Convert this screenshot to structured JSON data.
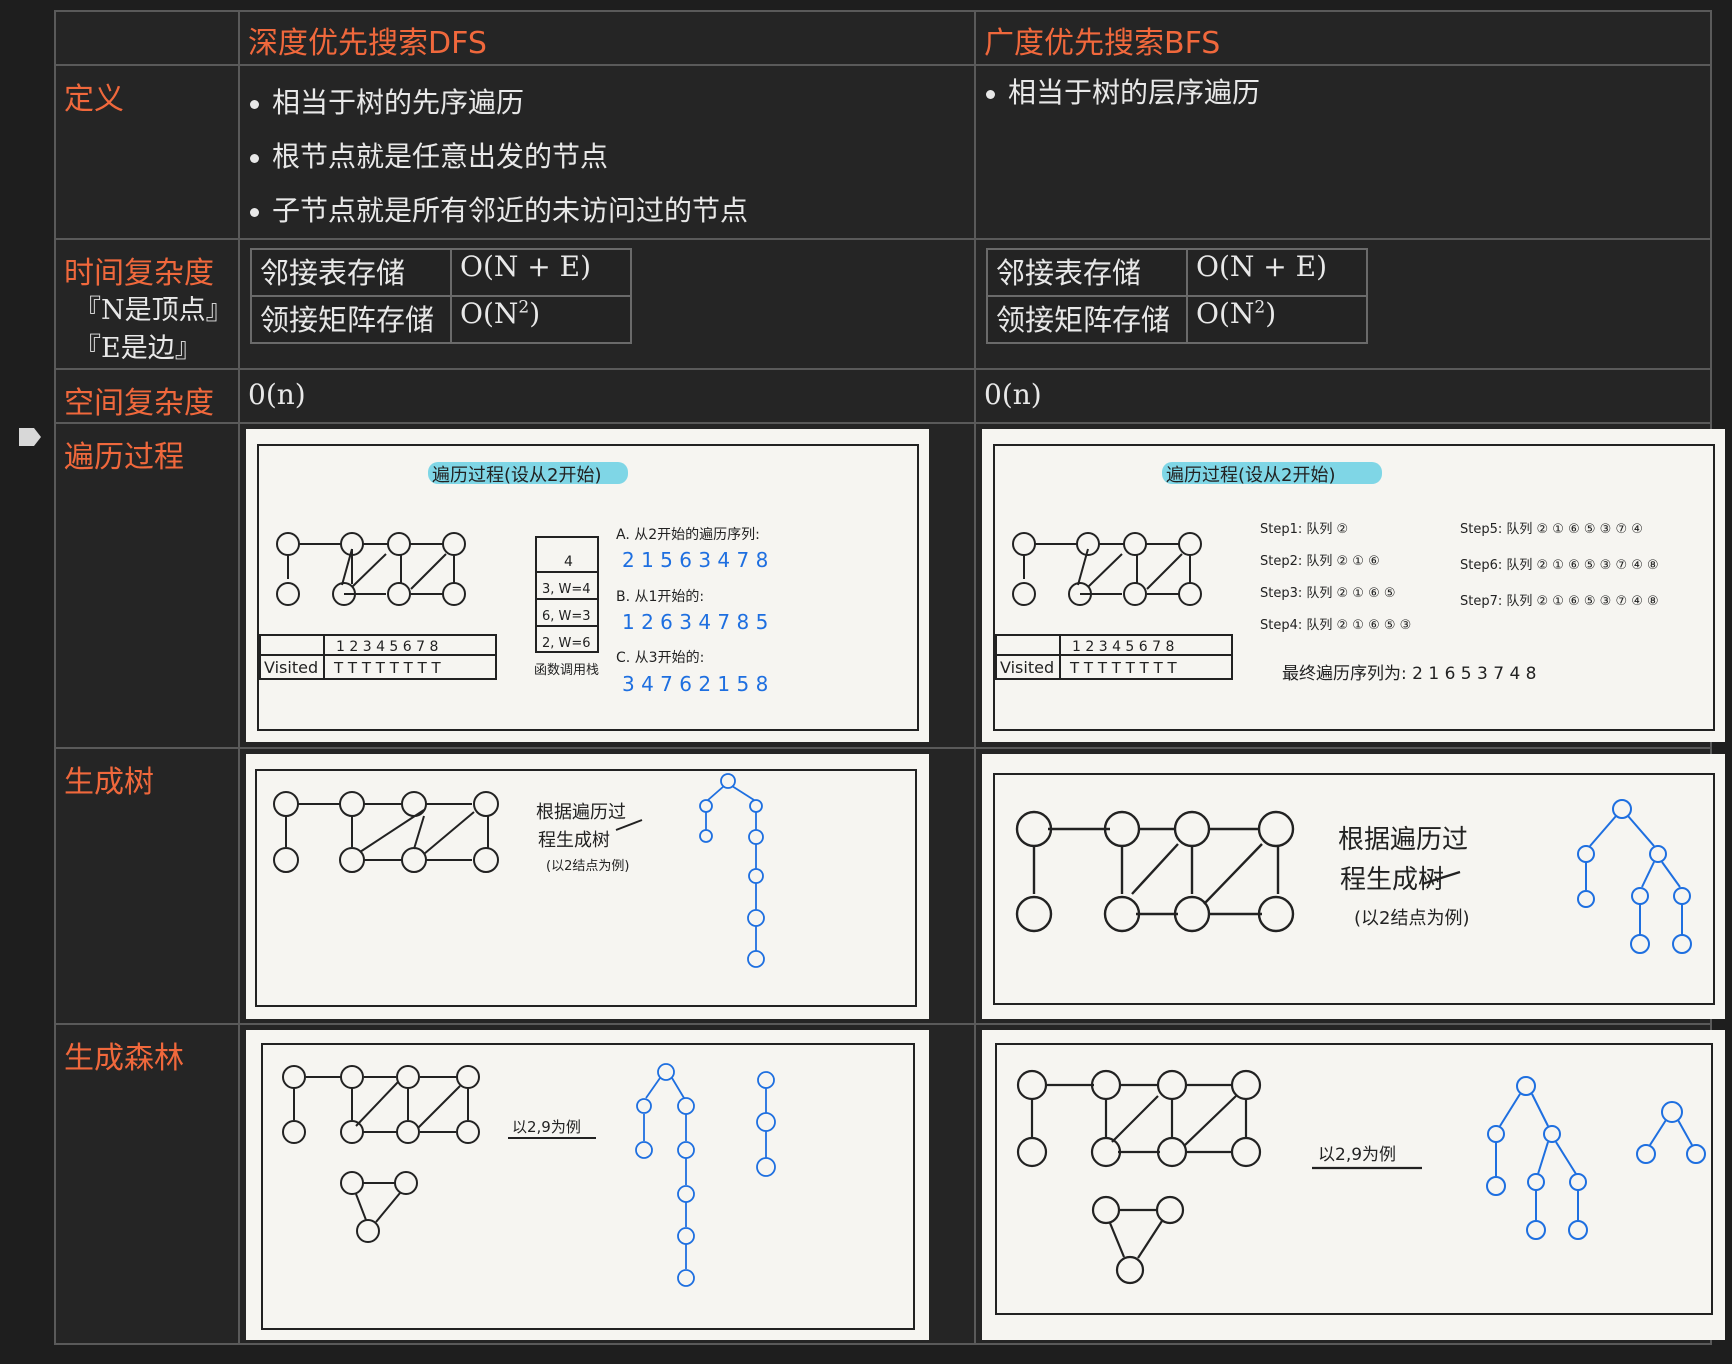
{
  "columns": {
    "dfs": "深度优先搜索DFS",
    "bfs": "广度优先搜索BFS"
  },
  "rows": {
    "definition": "定义",
    "time": "时间复杂度",
    "time_note1": "『N是顶点』",
    "time_note2": "『E是边』",
    "space": "空间复杂度",
    "traversal": "遍历过程",
    "tree": "生成树",
    "forest": "生成森林"
  },
  "dfs_definition": [
    "相当于树的先序遍历",
    "根节点就是任意出发的节点",
    "子节点就是所有邻近的未访问过的节点"
  ],
  "bfs_definition": [
    "相当于树的层序遍历"
  ],
  "complexity": {
    "adj_list": "邻接表存储",
    "adj_list_val": "O(N + E)",
    "adj_matrix": "领接矩阵存储",
    "adj_matrix_val": "O(N",
    "sup": "2",
    "close": ")"
  },
  "space_val": "0(n)",
  "sketch": {
    "title": "遍历过程(设从2开始)",
    "visited": "Visited",
    "nums": "1 2 3 4 5 6 7 8",
    "ts": "T T T T T T T T",
    "stack_label": "函数调用栈",
    "stack": [
      "4",
      "3, W=4",
      "6, W=3",
      "2, W=6"
    ],
    "dfs_a": "A. 从2开始的遍历序列:",
    "dfs_a_seq": "2 1 5 6 3 4 7 8",
    "dfs_b": "B. 从1开始的:",
    "dfs_b_seq": "1 2 6 3 4 7 8 5",
    "dfs_c": "C. 从3开始的:",
    "dfs_c_seq": "3 4 7 6 2 1 5 8",
    "bfs_steps": [
      "Step1: 队列 ②",
      "Step2: 队列 ② ① ⑥",
      "Step3: 队列 ② ① ⑥ ⑤",
      "Step4: 队列 ② ① ⑥ ⑤ ③",
      "Step5: 队列 ② ① ⑥ ⑤ ③ ⑦ ④",
      "Step6: 队列 ② ① ⑥ ⑤ ③ ⑦ ④ ⑧",
      "Step7: 队列 ② ① ⑥ ⑤ ③ ⑦ ④ ⑧"
    ],
    "bfs_final": "最终遍历序列为: 2 1 6 5 3 7 4 8",
    "tree_note1": "根据遍历过",
    "tree_note2": "程生成树",
    "tree_note3": "(以2结点为例)",
    "forest_note": "以2,9为例"
  },
  "colors": {
    "accent": "#f0683c",
    "ink_blue": "#1e6fe0"
  }
}
